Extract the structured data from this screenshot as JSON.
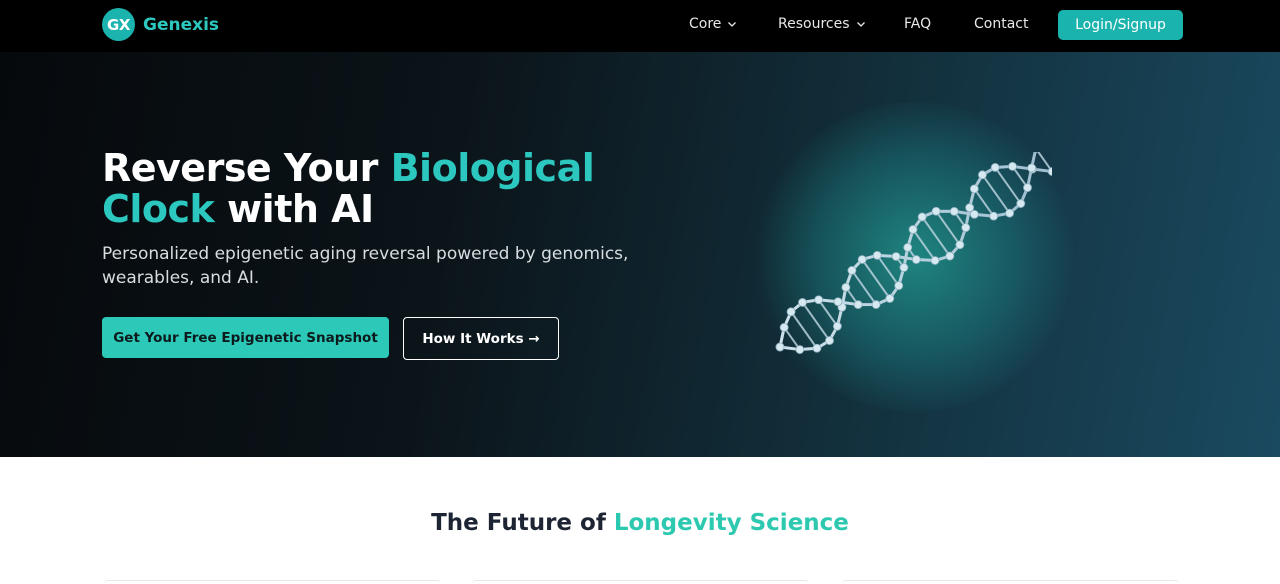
{
  "brand": {
    "badge": "GX",
    "name": "Genexis"
  },
  "nav": {
    "items": [
      {
        "label": "Core",
        "dropdown": true
      },
      {
        "label": "Resources",
        "dropdown": true
      },
      {
        "label": "FAQ",
        "dropdown": false
      },
      {
        "label": "Contact",
        "dropdown": false
      }
    ],
    "login_label": "Login/Signup"
  },
  "hero": {
    "headline_part1": "Reverse Your ",
    "headline_accent1": "Biological",
    "headline_accent2": "Clock",
    "headline_part2": " with AI",
    "subtitle": "Personalized epigenetic aging reversal powered by genomics, wearables, and AI.",
    "cta_primary": "Get Your Free Epigenetic Snapshot",
    "cta_secondary": "How It Works →",
    "image": "dna-helix"
  },
  "section": {
    "title_part1": "The Future of ",
    "title_accent": "Longevity Science"
  },
  "colors": {
    "accent": "#2cc8c0",
    "button": "#1bb3ad",
    "topbar": "#000000",
    "heading_dark": "#1d2433"
  }
}
